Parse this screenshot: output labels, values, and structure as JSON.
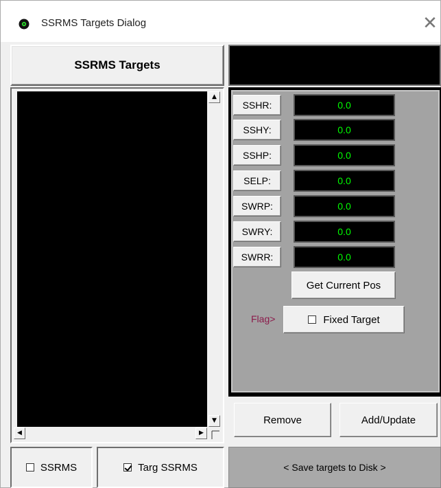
{
  "window": {
    "title": "SSRMS Targets Dialog",
    "close_glyph": "✕",
    "icon": "ssrms-app-icon"
  },
  "targets_panel": {
    "header": "SSRMS Targets"
  },
  "joints": [
    {
      "label": "SSHR:",
      "value": "0.0"
    },
    {
      "label": "SSHY:",
      "value": "0.0"
    },
    {
      "label": "SSHP:",
      "value": "0.0"
    },
    {
      "label": "SELP:",
      "value": "0.0"
    },
    {
      "label": "SWRP:",
      "value": "0.0"
    },
    {
      "label": "SWRY:",
      "value": "0.0"
    },
    {
      "label": "SWRR:",
      "value": "0.0"
    }
  ],
  "actions": {
    "get_current_pos": "Get Current Pos",
    "flag_label": "Flag>",
    "fixed_target": "Fixed Target",
    "fixed_target_checked": false,
    "remove": "Remove",
    "add_update": "Add/Update",
    "save": "< Save targets to Disk >"
  },
  "footer": {
    "ssrms_label": "SSRMS",
    "ssrms_checked": false,
    "targ_ssrms_label": "Targ SSRMS",
    "targ_ssrms_checked": true
  },
  "colors": {
    "value_text": "#00ff00",
    "flag_text": "#8b1a4a",
    "panel_gray": "#a3a3a3"
  },
  "scroll_glyphs": {
    "up": "▲",
    "down": "▼",
    "left": "◀",
    "right": "▶"
  }
}
